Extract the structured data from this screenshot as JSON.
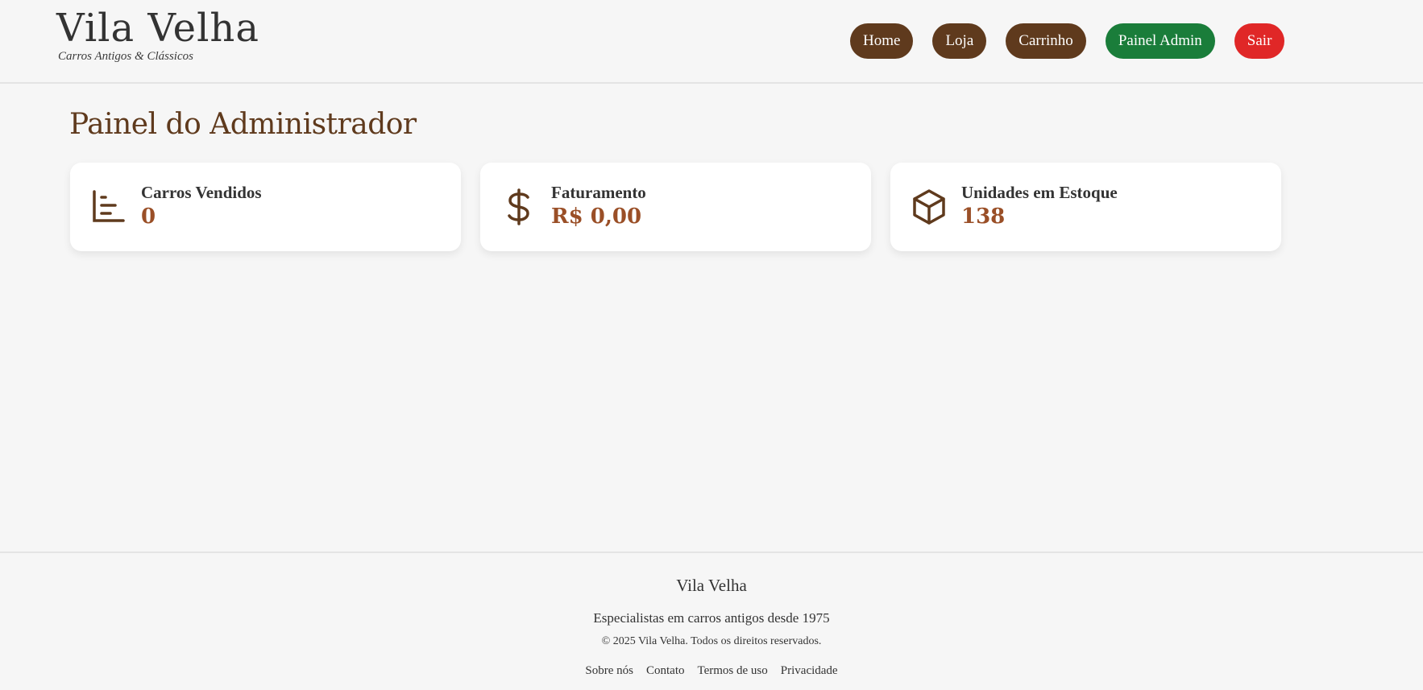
{
  "header": {
    "brand_title": "Vila Velha",
    "brand_tagline": "Carros Antigos & Clássicos",
    "nav": [
      {
        "label": "Home",
        "color": "#5f3a1d"
      },
      {
        "label": "Loja",
        "color": "#5f3a1d"
      },
      {
        "label": "Carrinho",
        "color": "#5f3a1d"
      },
      {
        "label": "Painel Admin",
        "color": "#1a7d3a"
      },
      {
        "label": "Sair",
        "color": "#e02727"
      }
    ]
  },
  "main": {
    "title": "Painel do Administrador",
    "stats": [
      {
        "icon": "bar-chart-icon",
        "label": "Carros Vendidos",
        "value": "0"
      },
      {
        "icon": "dollar-icon",
        "label": "Faturamento",
        "value": "R$ 0,00"
      },
      {
        "icon": "box-icon",
        "label": "Unidades em Estoque",
        "value": "138"
      }
    ]
  },
  "footer": {
    "brand": "Vila Velha",
    "tagline": "Especialistas em carros antigos desde 1975",
    "copyright": "© 2025 Vila Velha. Todos os direitos reservados.",
    "links": [
      "Sobre nós",
      "Contato",
      "Termos de uso",
      "Privacidade"
    ]
  },
  "colors": {
    "brown": "#5f3a1d",
    "green": "#1a7d3a",
    "red": "#e02727",
    "value_accent": "#9a4f27",
    "background": "#f6f6f6"
  }
}
